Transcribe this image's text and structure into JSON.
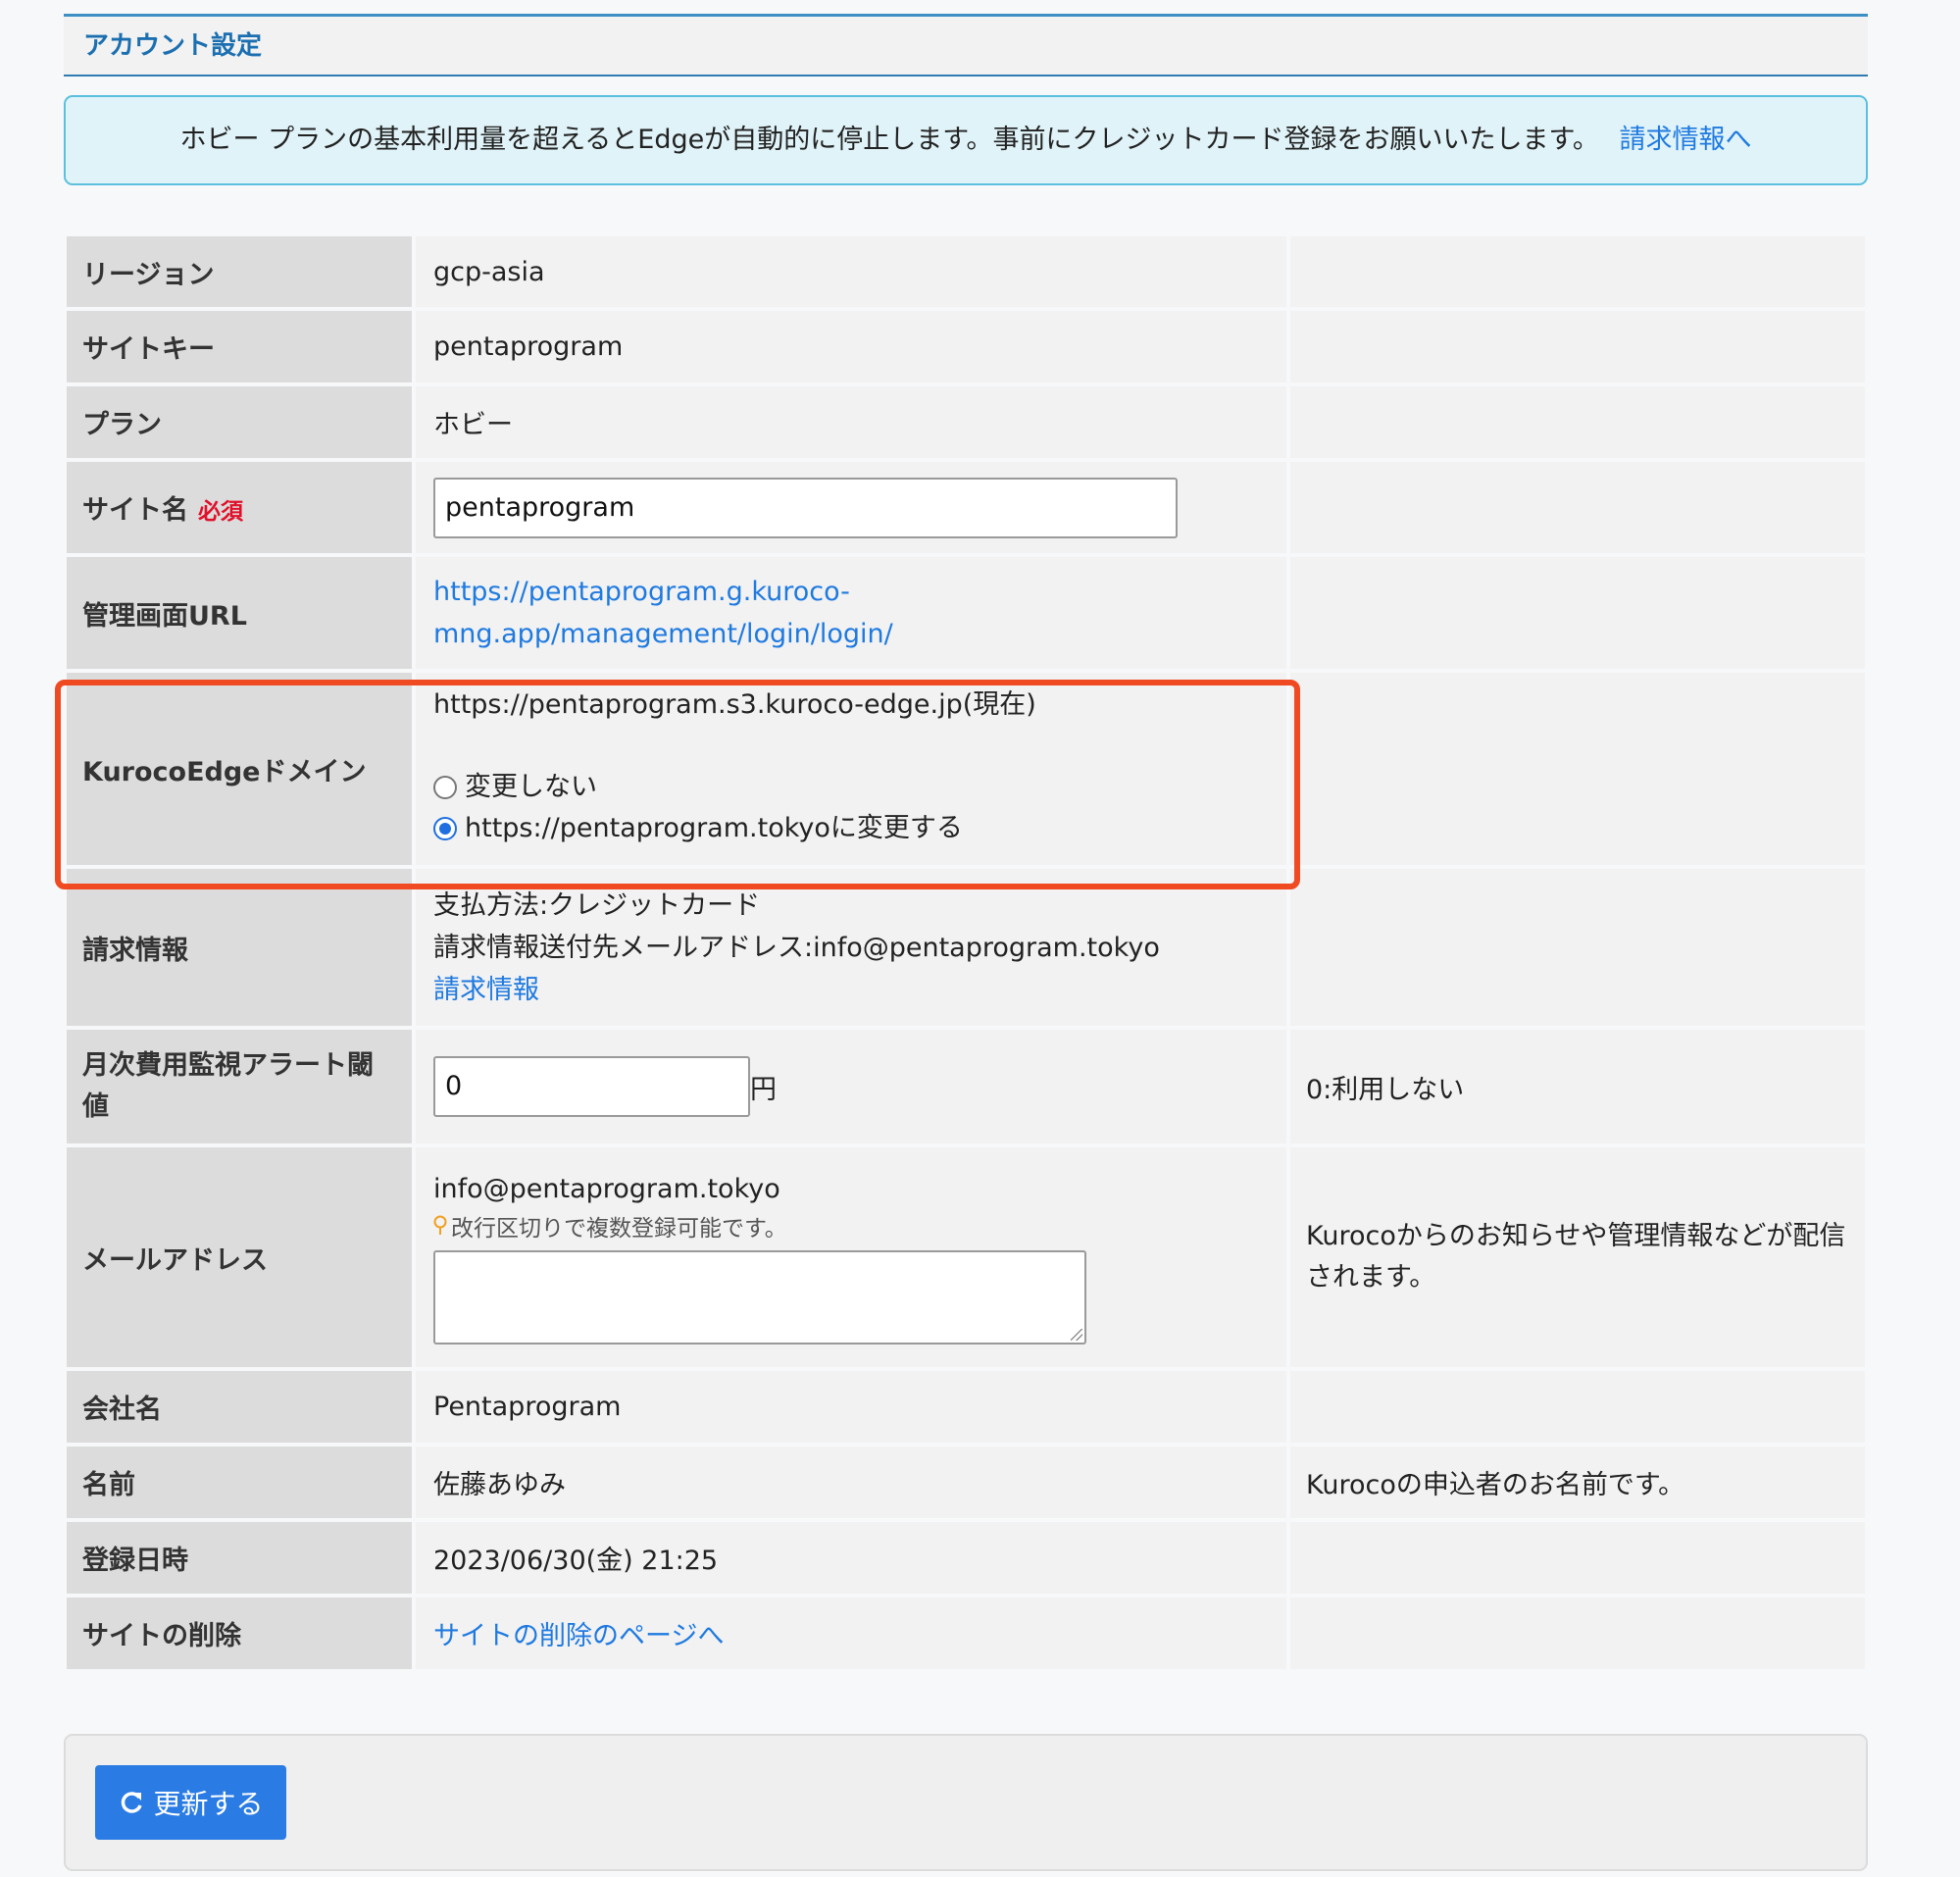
{
  "panel": {
    "title": "アカウント設定"
  },
  "notice": {
    "text": "ホビー プランの基本利用量を超えるとEdgeが自動的に停止します。事前にクレジットカード登録をお願いいたします。",
    "link": "請求情報へ"
  },
  "rows": {
    "region": {
      "label": "リージョン",
      "value": "gcp-asia"
    },
    "site_key": {
      "label": "サイトキー",
      "value": "pentaprogram"
    },
    "plan": {
      "label": "プラン",
      "value": "ホビー"
    },
    "site_name": {
      "label": "サイト名",
      "required": "必須",
      "value": "pentaprogram"
    },
    "admin_url": {
      "label": "管理画面URL",
      "line1": "https://pentaprogram.g.kuroco-",
      "line2": "mng.app/management/login/login/"
    },
    "edge_domain": {
      "label": "KurocoEdgeドメイン",
      "current": "https://pentaprogram.s3.kuroco-edge.jp(現在)",
      "option_keep": "変更しない",
      "option_change": "https://pentaprogram.tokyoに変更する",
      "selected": "option_change"
    },
    "billing": {
      "label": "請求情報",
      "method": "支払方法:クレジットカード",
      "email": "請求情報送付先メールアドレス:info@pentaprogram.tokyo",
      "link": "請求情報"
    },
    "alert_threshold": {
      "label": "月次費用監視アラート閾値",
      "value": "0",
      "unit": "円",
      "note": "0:利用しない"
    },
    "email": {
      "label": "メールアドレス",
      "value": "info@pentaprogram.tokyo",
      "hint": "改行区切りで複数登録可能です。",
      "textarea": "",
      "note": "Kurocoからのお知らせや管理情報などが配信されます。"
    },
    "company": {
      "label": "会社名",
      "value": "Pentaprogram"
    },
    "name": {
      "label": "名前",
      "value": "佐藤あゆみ",
      "note": "Kurocoの申込者のお名前です。"
    },
    "registered": {
      "label": "登録日時",
      "value": "2023/06/30(金) 21:25"
    },
    "delete": {
      "label": "サイトの削除",
      "link": "サイトの削除のページへ"
    }
  },
  "footer": {
    "update_button": "更新する"
  },
  "colors": {
    "accent": "#2a7be4",
    "link": "#1f7ae0",
    "highlight": "#f04a23",
    "notice_bg": "#e0f3f8"
  }
}
